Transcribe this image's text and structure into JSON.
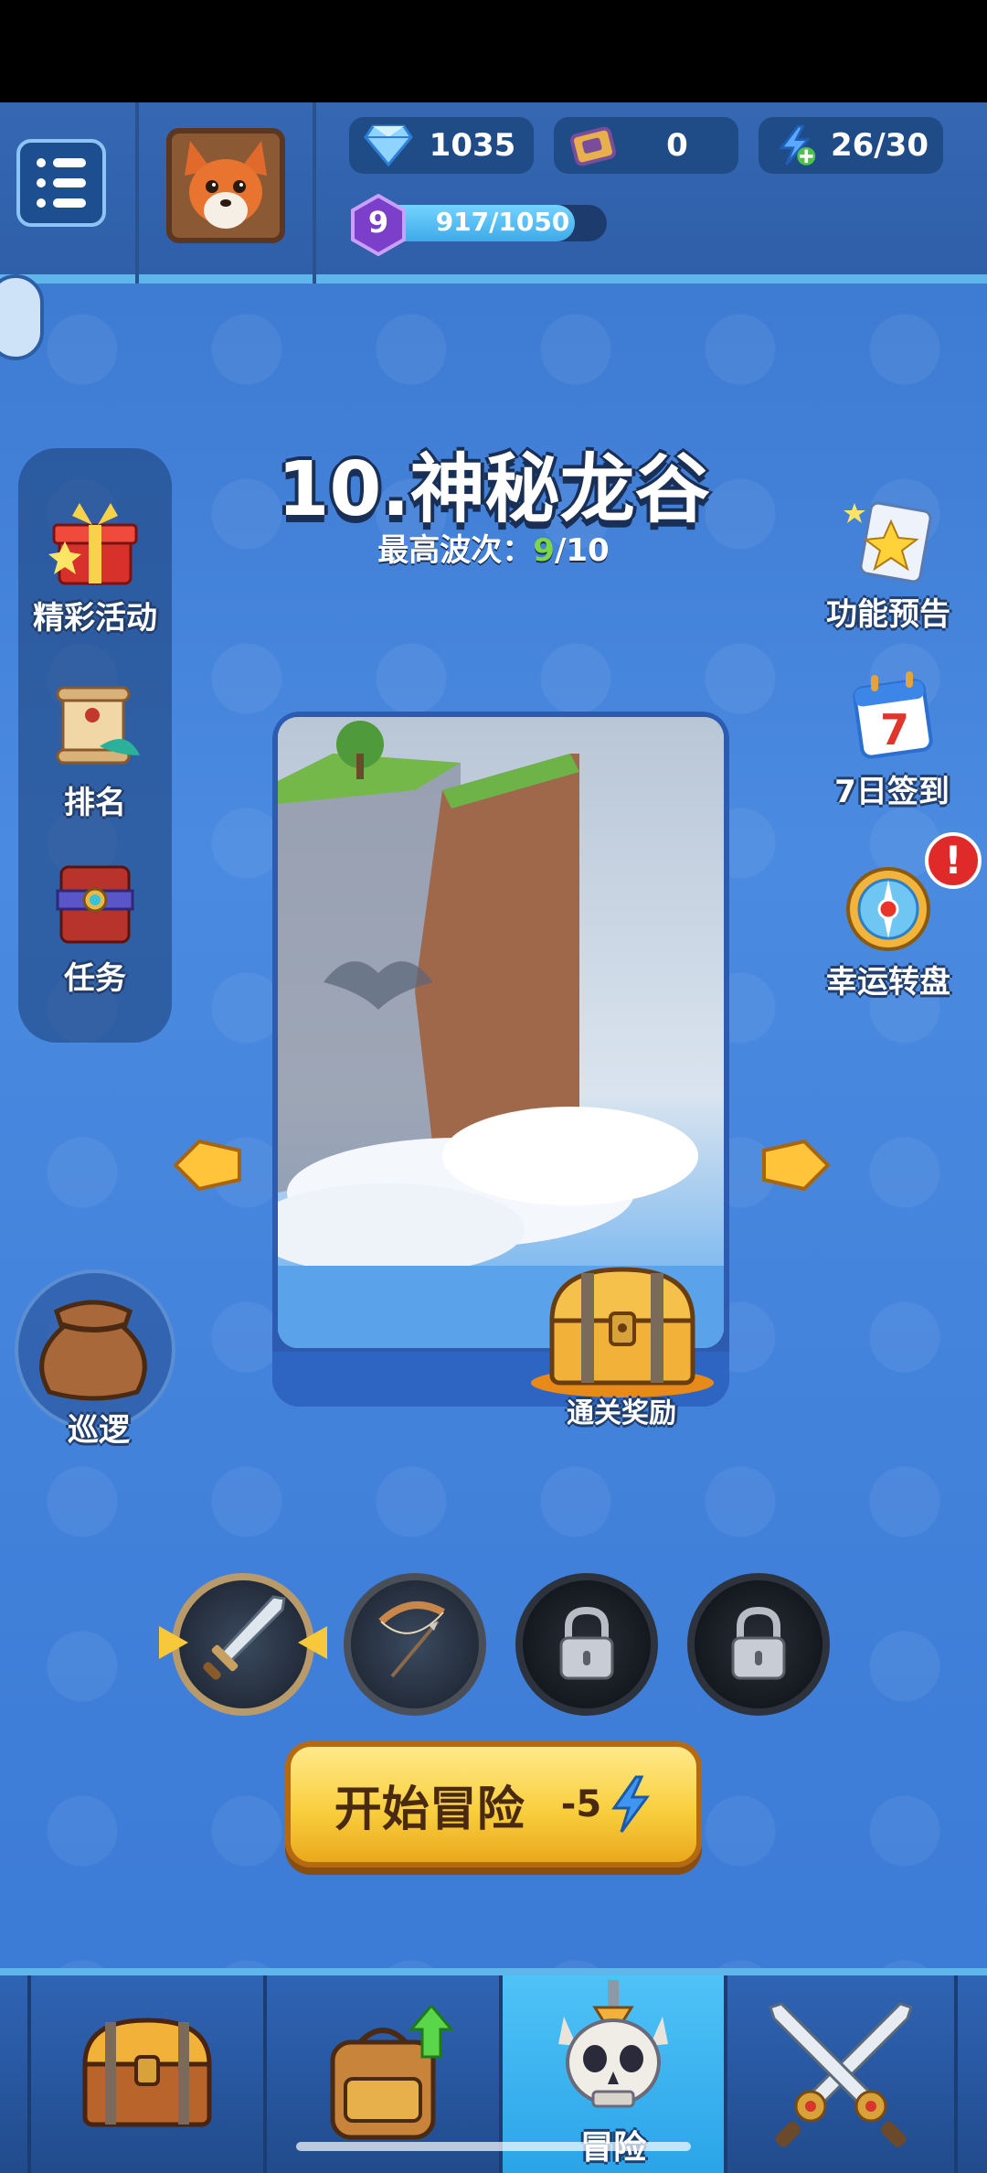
{
  "header": {
    "gems": "1035",
    "tickets": "0",
    "energy": "26/30",
    "level": "9",
    "xp_text": "917/1050",
    "xp_fraction": 0.873
  },
  "left_features": [
    {
      "label": "精彩活动",
      "icon": "gift-box-icon"
    },
    {
      "label": "排名",
      "icon": "scroll-icon"
    },
    {
      "label": "任务",
      "icon": "quest-book-icon"
    }
  ],
  "right_features": [
    {
      "label": "功能预告",
      "icon": "notepad-star-icon"
    },
    {
      "label": "7日签到",
      "icon": "calendar-icon",
      "calendar_day": "7"
    },
    {
      "label": "幸运转盘",
      "icon": "lucky-wheel-icon",
      "alert": "!"
    }
  ],
  "stage": {
    "title": "10.神秘龙谷",
    "wave_label": "最高波次：",
    "wave_best": "9",
    "wave_total": "/10",
    "reward_label": "通关奖励"
  },
  "patrol": {
    "label": "巡逻",
    "icon": "pouch-icon"
  },
  "weapons": [
    {
      "name": "sword",
      "icon": "sword-icon",
      "selected": true,
      "locked": false
    },
    {
      "name": "bow",
      "icon": "bow-icon",
      "selected": false,
      "locked": false
    },
    {
      "name": "locked-weapon-1",
      "icon": "lock-icon",
      "selected": false,
      "locked": true
    },
    {
      "name": "locked-weapon-2",
      "icon": "lock-icon",
      "selected": false,
      "locked": true
    }
  ],
  "start_button": {
    "label": "开始冒险",
    "cost": "-5"
  },
  "bottom_nav": {
    "tabs": [
      {
        "icon": "treasure-chest-icon"
      },
      {
        "icon": "backpack-icon"
      },
      {
        "icon": "skull-icon",
        "label": "冒险",
        "active": true
      },
      {
        "icon": "crossed-swords-icon"
      }
    ]
  },
  "colors": {
    "background": "#3f7fd4",
    "accent_cyan": "#5fb6ea",
    "button_yellow": "#f9cf3f",
    "wave_green": "#7bd64a"
  }
}
